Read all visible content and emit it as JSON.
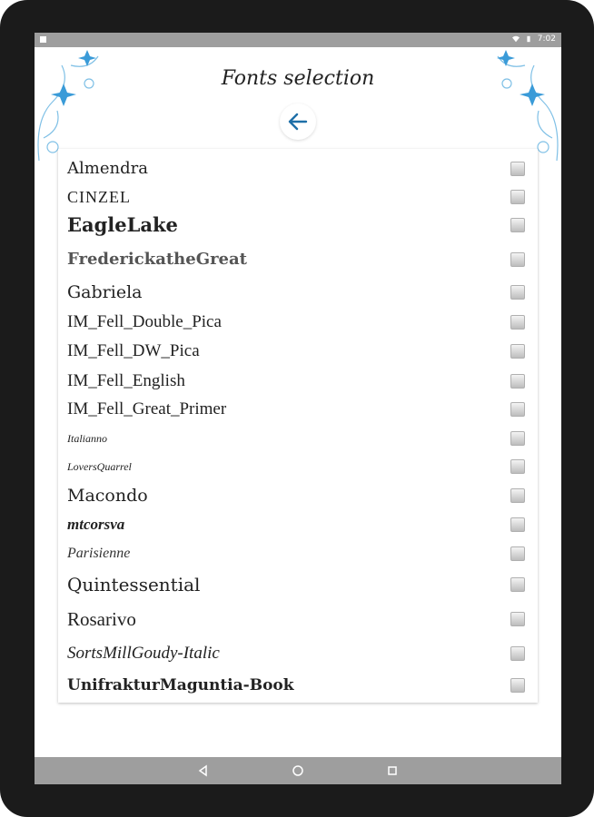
{
  "status": {
    "time": "7:02",
    "icons": [
      "notification-icon",
      "wifi-icon",
      "battery-icon"
    ]
  },
  "header": {
    "title": "Fonts selection",
    "back_icon": "arrow-left-icon",
    "accent": "#1e6fa8"
  },
  "fonts": [
    {
      "label": "Almendra",
      "checked": false
    },
    {
      "label": "CINZEL",
      "checked": false
    },
    {
      "label": "EagleLake",
      "checked": false
    },
    {
      "label": "FrederickatheGreat",
      "checked": false
    },
    {
      "label": "Gabriela",
      "checked": false
    },
    {
      "label": "IM_Fell_Double_Pica",
      "checked": false
    },
    {
      "label": "IM_Fell_DW_Pica",
      "checked": false
    },
    {
      "label": "IM_Fell_English",
      "checked": false
    },
    {
      "label": "IM_Fell_Great_Primer",
      "checked": false
    },
    {
      "label": "Italianno",
      "checked": false
    },
    {
      "label": "LoversQuarrel",
      "checked": false
    },
    {
      "label": "Macondo",
      "checked": false
    },
    {
      "label": "mtcorsva",
      "checked": false
    },
    {
      "label": "Parisienne",
      "checked": false
    },
    {
      "label": "Quintessential",
      "checked": false
    },
    {
      "label": "Rosarivo",
      "checked": false
    },
    {
      "label": "SortsMillGoudy-Italic",
      "checked": false
    },
    {
      "label": "UnifrakturMaguntia-Book",
      "checked": false
    }
  ],
  "navbar": {
    "icons": [
      "back-triangle-icon",
      "home-circle-icon",
      "recents-square-icon"
    ]
  }
}
